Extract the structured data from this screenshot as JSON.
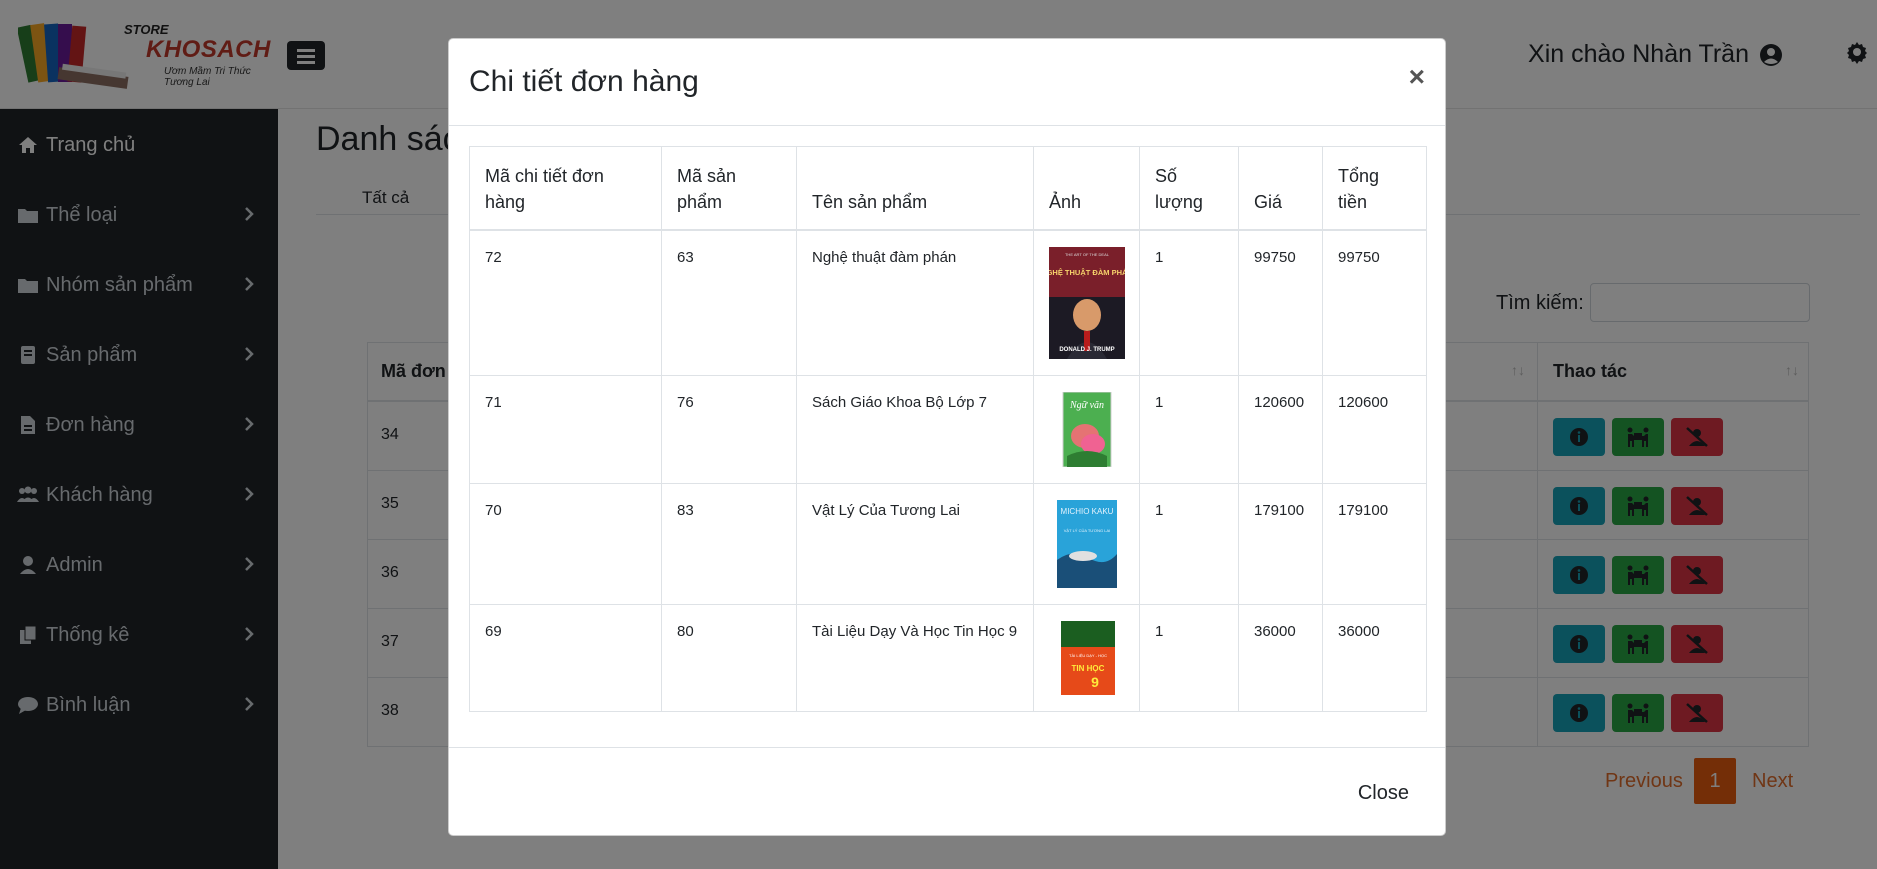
{
  "header": {
    "logo": {
      "store_label": "STORE",
      "brand": "KHOSACH",
      "slogan": "Ươm Mầm Tri Thức Tương Lai"
    },
    "greeting": "Xin chào Nhàn Trần",
    "icons": {
      "menu": "hamburger-icon",
      "user": "user-circle-icon",
      "settings": "gear-icon"
    }
  },
  "sidebar": {
    "items": [
      {
        "label": "Trang chủ",
        "icon": "home-icon",
        "active": true
      },
      {
        "label": "Thể loại",
        "icon": "folder-icon"
      },
      {
        "label": "Nhóm sản phẩm",
        "icon": "folder-icon"
      },
      {
        "label": "Sản phẩm",
        "icon": "book-icon"
      },
      {
        "label": "Đơn hàng",
        "icon": "file-icon"
      },
      {
        "label": "Khách hàng",
        "icon": "users-icon"
      },
      {
        "label": "Admin",
        "icon": "user-icon"
      },
      {
        "label": "Thống kê",
        "icon": "copy-icon"
      },
      {
        "label": "Bình luận",
        "icon": "comment-icon"
      }
    ]
  },
  "main": {
    "title": "Danh sác",
    "tab_all": "Tất cả",
    "search_label": "Tìm kiếm:",
    "table": {
      "col_order_id": "Mã đơn",
      "col_actions": "Thao tác",
      "rows": [
        "34",
        "35",
        "36",
        "37",
        "38"
      ]
    },
    "pagination": {
      "previous": "Previous",
      "current": "1",
      "next": "Next"
    }
  },
  "modal": {
    "title": "Chi tiết đơn hàng",
    "close_x": "×",
    "close_button": "Close",
    "columns": {
      "detail_id": "Mã chi tiết đơn hàng",
      "product_id": "Mã sản phẩm",
      "product_name": "Tên sản phẩm",
      "image": "Ảnh",
      "quantity": "Số lượng",
      "price": "Giá",
      "total": "Tổng tiền"
    },
    "rows": [
      {
        "detail_id": "72",
        "product_id": "63",
        "name": "Nghệ thuật đàm phán",
        "quantity": "1",
        "price": "99750",
        "total": "99750",
        "cover": {
          "top_text": "THE ART OF THE DEAL",
          "title": "NGHỆ THUẬT ĐÀM PHÁN",
          "author": "DONALD J. TRUMP"
        }
      },
      {
        "detail_id": "71",
        "product_id": "76",
        "name": "Sách Giáo Khoa Bộ Lớp 7",
        "quantity": "1",
        "price": "120600",
        "total": "120600",
        "cover": {
          "title": "Ngữ văn"
        }
      },
      {
        "detail_id": "70",
        "product_id": "83",
        "name": "Vật Lý Của Tương Lai",
        "quantity": "1",
        "price": "179100",
        "total": "179100",
        "cover": {
          "author": "MICHIO KAKU",
          "title": "VẬT LÝ CỦA TƯƠNG LAI"
        }
      },
      {
        "detail_id": "69",
        "product_id": "80",
        "name": "Tài Liệu Dạy Và Học Tin Học 9",
        "quantity": "1",
        "price": "36000",
        "total": "36000",
        "cover": {
          "top_text": "TÀI LIỆU DẠY - HỌC",
          "title": "TIN HỌC",
          "grade": "9"
        }
      }
    ]
  }
}
